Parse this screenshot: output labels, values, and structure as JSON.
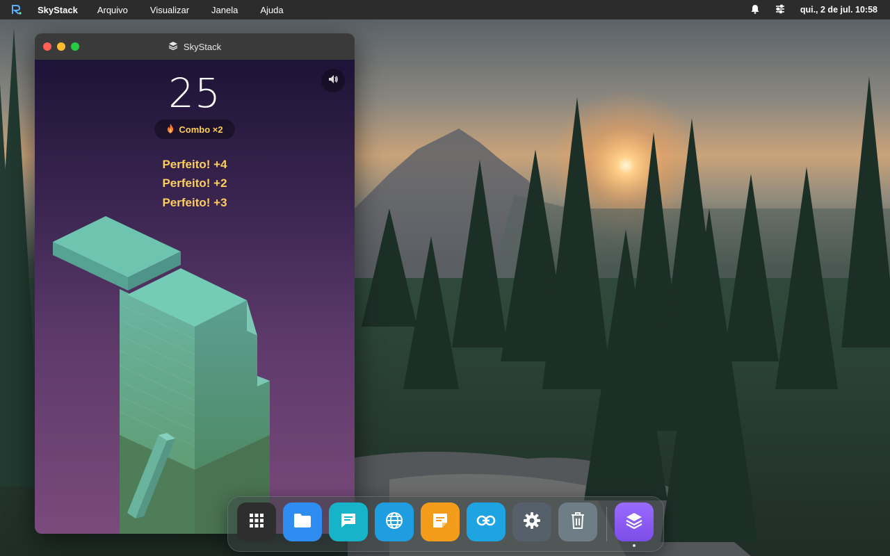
{
  "menubar": {
    "app_name": "SkyStack",
    "menus": [
      "Arquivo",
      "Visualizar",
      "Janela",
      "Ajuda"
    ],
    "clock": "qui., 2 de jul. 10:58",
    "icons": [
      "bell-icon",
      "sliders-icon"
    ]
  },
  "window": {
    "title": "SkyStack",
    "icon": "layers-icon"
  },
  "game": {
    "score": "25",
    "combo": "Combo ×2",
    "combo_icon": "flame-icon",
    "sound_icon": "speaker-icon",
    "messages": [
      "Perfeito! +4",
      "Perfeito! +2",
      "Perfeito! +3"
    ],
    "colors": {
      "block_top": "#6cc3ae",
      "bg_top": "#1d1336",
      "bg_bottom": "#7a4a7c",
      "accent": "#ffcf5c"
    }
  },
  "dock": {
    "items": [
      {
        "name": "apps-grid",
        "icon": "grid-icon",
        "color": "#2e2e2e"
      },
      {
        "name": "files",
        "icon": "folder-icon",
        "color": "#2f8cf0"
      },
      {
        "name": "messages",
        "icon": "chat-icon",
        "color": "#17b3c9"
      },
      {
        "name": "browser",
        "icon": "globe-icon",
        "color": "#1e9de0"
      },
      {
        "name": "notes",
        "icon": "note-icon",
        "color": "#f39c1b"
      },
      {
        "name": "links",
        "icon": "link-icon",
        "color": "#1ea4e0"
      },
      {
        "name": "settings",
        "icon": "gear-icon",
        "color": "#56606b"
      },
      {
        "name": "trash",
        "icon": "trash-icon",
        "color": "#6f7d86"
      },
      {
        "name": "skystack",
        "icon": "layers-icon",
        "color": "#8b5cf6"
      }
    ]
  }
}
